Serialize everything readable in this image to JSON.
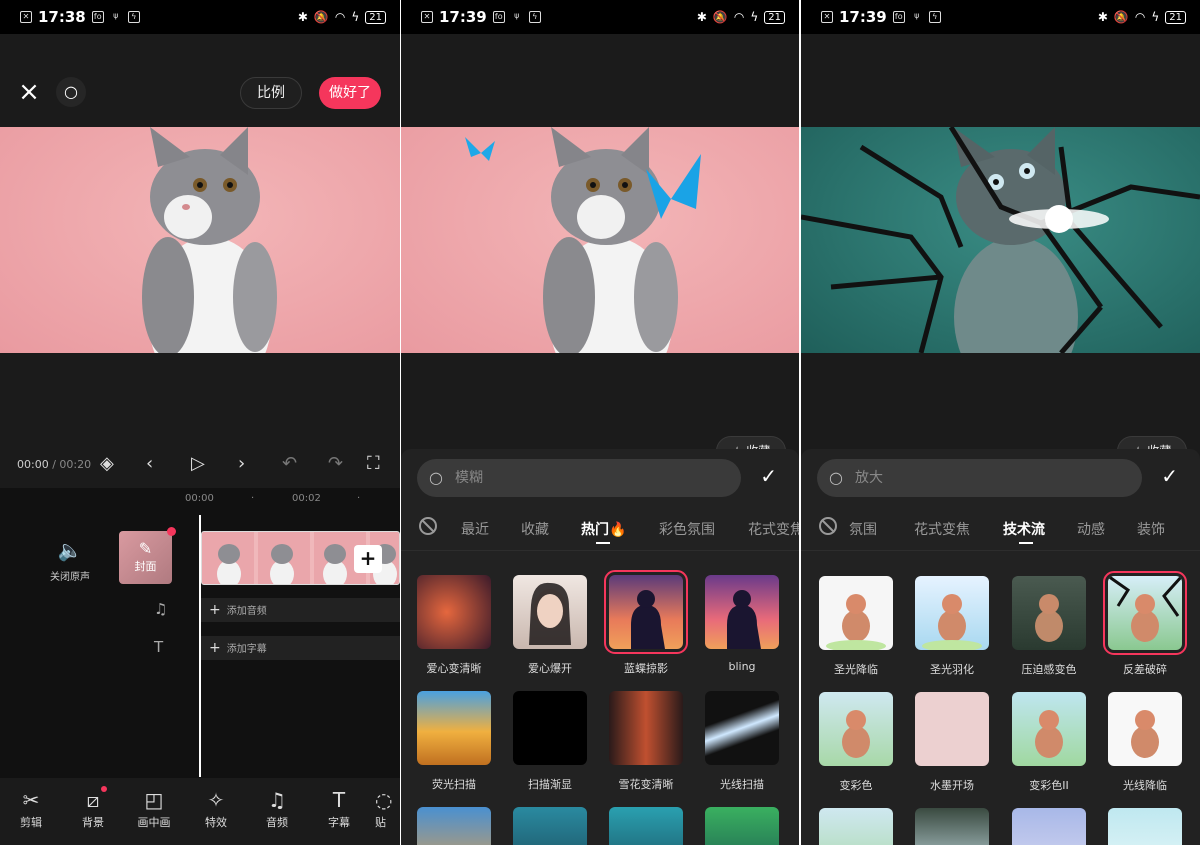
{
  "panels": [
    {
      "status": {
        "time": "17:38",
        "battery": "21"
      },
      "toolbar": {
        "ratio_label": "比例",
        "done_label": "做好了"
      },
      "playbar": {
        "current": "00:00",
        "total": "/ 00:20"
      },
      "ruler": [
        "00:00",
        "00:02"
      ],
      "timeline": {
        "mute_label": "关闭原声",
        "cover_label": "封面",
        "add_audio": "添加音频",
        "add_subtitle": "添加字幕"
      },
      "nav": [
        "剪辑",
        "背景",
        "画中画",
        "特效",
        "音频",
        "字幕",
        "贴"
      ]
    },
    {
      "status": {
        "time": "17:39",
        "battery": "21"
      },
      "fav_label": "收藏",
      "search_placeholder": "模糊",
      "tabs": [
        "最近",
        "收藏",
        "热门🔥",
        "彩色氛围",
        "花式变焦"
      ],
      "active_tab": "热门🔥",
      "effects": [
        "爱心变清晰",
        "爱心爆开",
        "蓝蝶掠影",
        "bling",
        "荧光扫描",
        "扫描渐显",
        "雪花变清晰",
        "光线扫描"
      ]
    },
    {
      "status": {
        "time": "17:39",
        "battery": "21"
      },
      "fav_label": "收藏",
      "search_placeholder": "放大",
      "tabs": [
        "氛围",
        "花式变焦",
        "技术流",
        "动感",
        "装饰"
      ],
      "active_tab": "技术流",
      "effects": [
        "圣光降临",
        "圣光羽化",
        "压迫感变色",
        "反差破碎",
        "变彩色",
        "水墨开场",
        "变彩色II",
        "光线降临"
      ]
    }
  ],
  "colors": {
    "accent": "#f5365c",
    "bg": "#1b1b1b",
    "sheet": "#222222"
  }
}
